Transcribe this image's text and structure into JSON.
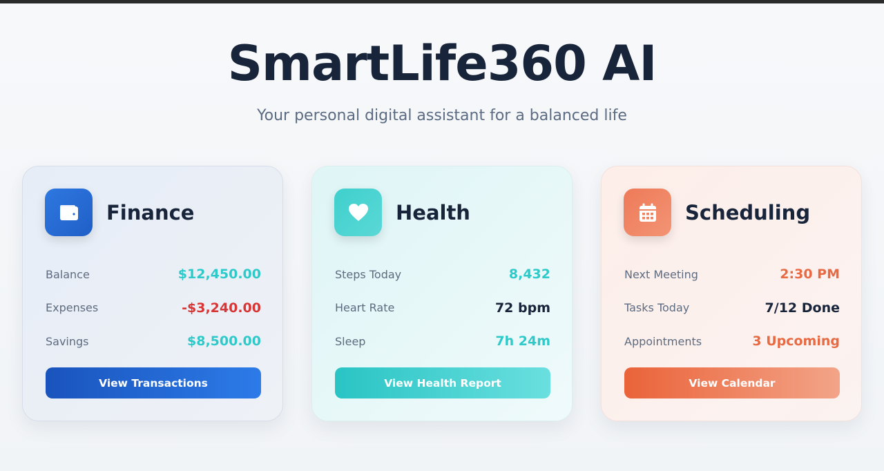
{
  "app": {
    "title": "SmartLife360 AI",
    "subtitle": "Your personal digital assistant for a balanced life"
  },
  "colors": {
    "teal": "#2ec9c9",
    "red": "#d93535",
    "orange": "#e86a43",
    "dark": "#18243a"
  },
  "cards": {
    "finance": {
      "title": "Finance",
      "icon": "wallet-icon",
      "rows": [
        {
          "label": "Balance",
          "value": "$12,450.00",
          "color": "#2ec9c9"
        },
        {
          "label": "Expenses",
          "value": "-$3,240.00",
          "color": "#d93535"
        },
        {
          "label": "Savings",
          "value": "$8,500.00",
          "color": "#2ec9c9"
        }
      ],
      "button": "View Transactions"
    },
    "health": {
      "title": "Health",
      "icon": "heart-icon",
      "rows": [
        {
          "label": "Steps Today",
          "value": "8,432",
          "color": "#2ec9c9"
        },
        {
          "label": "Heart Rate",
          "value": "72 bpm",
          "color": "#18243a"
        },
        {
          "label": "Sleep",
          "value": "7h 24m",
          "color": "#2ec9c9"
        }
      ],
      "button": "View Health Report"
    },
    "scheduling": {
      "title": "Scheduling",
      "icon": "calendar-icon",
      "rows": [
        {
          "label": "Next Meeting",
          "value": "2:30 PM",
          "color": "#e86a43"
        },
        {
          "label": "Tasks Today",
          "value": "7/12 Done",
          "color": "#18243a"
        },
        {
          "label": "Appointments",
          "value": "3 Upcoming",
          "color": "#e86a43"
        }
      ],
      "button": "View Calendar"
    }
  }
}
